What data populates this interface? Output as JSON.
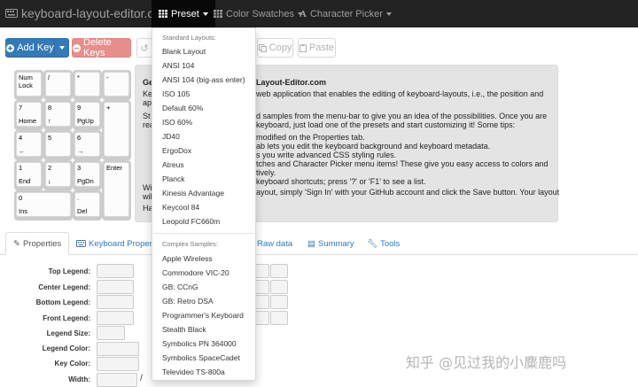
{
  "navbar": {
    "brand": "keyboard-layout-editor.com",
    "menus": [
      {
        "label": "Preset",
        "icon": "grid-icon"
      },
      {
        "label": "Color Swatches",
        "icon": "grid-icon"
      },
      {
        "label": "Character Picker",
        "icon": "font-icon"
      }
    ]
  },
  "toolbar": {
    "add_key": "Add Key",
    "delete_keys": "Delete Keys",
    "copy": "Copy",
    "paste": "Paste"
  },
  "keyboard": {
    "keys": [
      {
        "top": "Num",
        "bottom": "Lock"
      },
      {
        "top": "/",
        "bottom": ""
      },
      {
        "top": "*",
        "bottom": ""
      },
      {
        "top": "-",
        "bottom": ""
      },
      {
        "top": "7",
        "bottom": "Home"
      },
      {
        "top": "8",
        "bottom": "↑"
      },
      {
        "top": "9",
        "bottom": "PgUp"
      },
      {
        "top": "+",
        "bottom": ""
      },
      {
        "top": "4",
        "bottom": "←"
      },
      {
        "top": "5",
        "bottom": ""
      },
      {
        "top": "6",
        "bottom": "→"
      },
      {
        "top": "1",
        "bottom": "End"
      },
      {
        "top": "2",
        "bottom": "↓"
      },
      {
        "top": "3",
        "bottom": "PgDn"
      },
      {
        "top": "Enter",
        "bottom": ""
      },
      {
        "top": "0",
        "bottom": "Ins"
      },
      {
        "top": ".",
        "bottom": "Del"
      }
    ]
  },
  "intro": {
    "title_fragment": "Layout-Editor.com",
    "lines": [
      "web application that enables the editing of keyboard-layouts, i.e., the position and",
      "d samples from the menu-bar to give you an idea of the possibilities. Once you are",
      "keyboard, just load one of the presets and start customizing it! Some tips:",
      "modified on the Properties tab.",
      "ab lets you edit the keyboard background and keyboard metadata.",
      "s you write advanced CSS styling rules.",
      "tches and Character Picker menu items! These give you easy access to colors and",
      "tively.",
      "keyboard shortcuts; press '?' or 'F1' to see a list.",
      "ayout, simply 'Sign In' with your GitHub account and click the Save button. Your layout"
    ],
    "left_stubs": [
      "Ge",
      "Ke",
      "ap",
      "St",
      "rea",
      "Wi",
      "wil",
      "Ha"
    ]
  },
  "tabs": [
    {
      "label": "Properties",
      "icon": "pencil-icon"
    },
    {
      "label": "Keyboard Properties",
      "icon": "keyboard-icon"
    },
    {
      "label": "Raw data",
      "icon": "code-icon"
    },
    {
      "label": "Summary",
      "icon": "list-icon"
    },
    {
      "label": "Tools",
      "icon": "wrench-icon"
    }
  ],
  "properties_form": {
    "labels": [
      "Top Legend:",
      "Center Legend:",
      "Bottom Legend:",
      "Front Legend:",
      "Legend Size:",
      "Legend Color:",
      "Key Color:",
      "Width:"
    ],
    "width_separator": "/"
  },
  "preset_menu": {
    "standard_header": "Standard Layouts:",
    "standard": [
      "Blank Layout",
      "ANSI 104",
      "ANSI 104 (big-ass enter)",
      "ISO 105",
      "Default 60%",
      "ISO 60%",
      "JD40",
      "ErgoDox",
      "Atreus",
      "Planck",
      "Kinesis Advantage",
      "Keycool 84",
      "Leopold FC660m"
    ],
    "complex_header": "Complex Samples:",
    "complex": [
      "Apple Wireless",
      "Commodore VIC-20",
      "GB: CCnG",
      "GB: Retro DSA",
      "Programmer's Keyboard",
      "Stealth Black",
      "Symbolics PN 364000",
      "Symbolics SpaceCadet",
      "Televideo TS-800a"
    ]
  },
  "watermark": "知乎 @见过我的小麋鹿吗"
}
